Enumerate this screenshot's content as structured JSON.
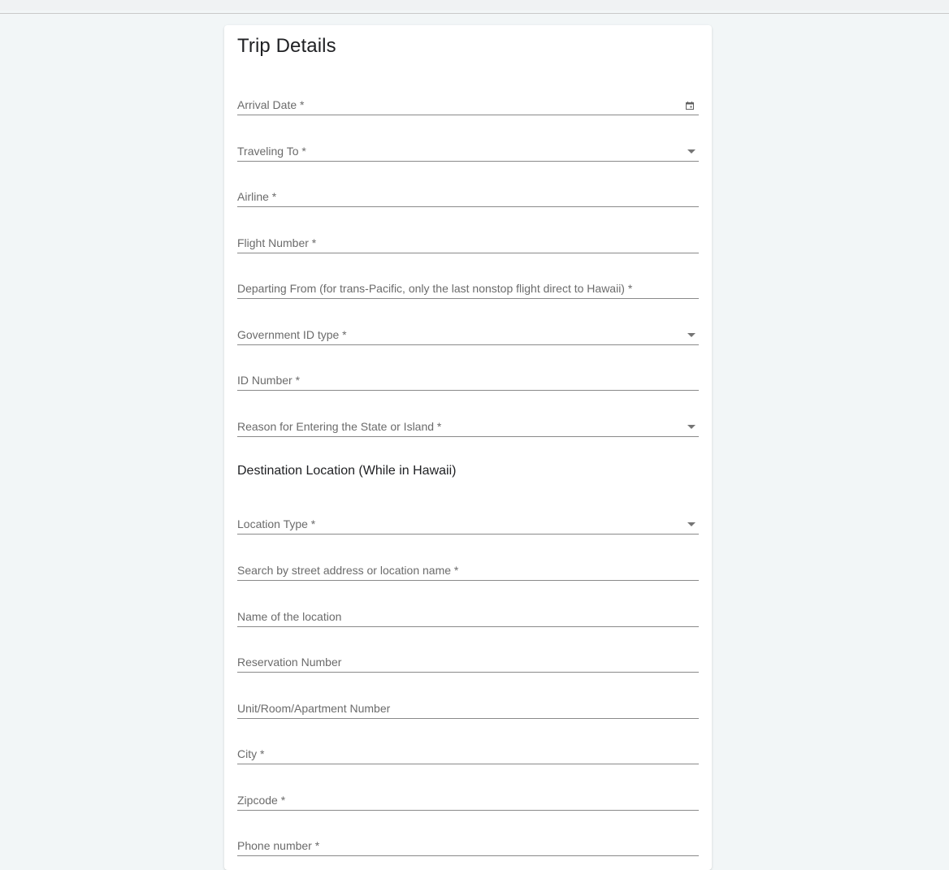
{
  "form": {
    "title": "Trip Details",
    "section_destination": "Destination Location (While in Hawaii)"
  },
  "fields": [
    {
      "label": "Arrival Date *",
      "type": "date",
      "icon": "calendar-icon"
    },
    {
      "label": "Traveling To *",
      "type": "select",
      "icon": "dropdown-arrow-icon"
    },
    {
      "label": "Airline *",
      "type": "text"
    },
    {
      "label": "Flight Number *",
      "type": "text"
    },
    {
      "label": "Departing From (for trans-Pacific, only the last nonstop flight direct to Hawaii) *",
      "type": "text"
    },
    {
      "label": "Government ID type *",
      "type": "select",
      "icon": "dropdown-arrow-icon"
    },
    {
      "label": "ID Number *",
      "type": "text"
    },
    {
      "label": "Reason for Entering the State or Island *",
      "type": "select",
      "icon": "dropdown-arrow-icon"
    },
    {
      "label": "Location Type *",
      "type": "select",
      "icon": "dropdown-arrow-icon"
    },
    {
      "label": "Search by street address or location name *",
      "type": "text"
    },
    {
      "label": "Name of the location",
      "type": "text"
    },
    {
      "label": "Reservation Number",
      "type": "text"
    },
    {
      "label": "Unit/Room/Apartment Number",
      "type": "text"
    },
    {
      "label": "City *",
      "type": "text"
    },
    {
      "label": "Zipcode *",
      "type": "text"
    },
    {
      "label": "Phone number *",
      "type": "text"
    }
  ],
  "colors": {
    "background": "#f2f6f7",
    "card": "#ffffff",
    "label": "#6b6b6b",
    "underline": "#8a8a8a"
  }
}
